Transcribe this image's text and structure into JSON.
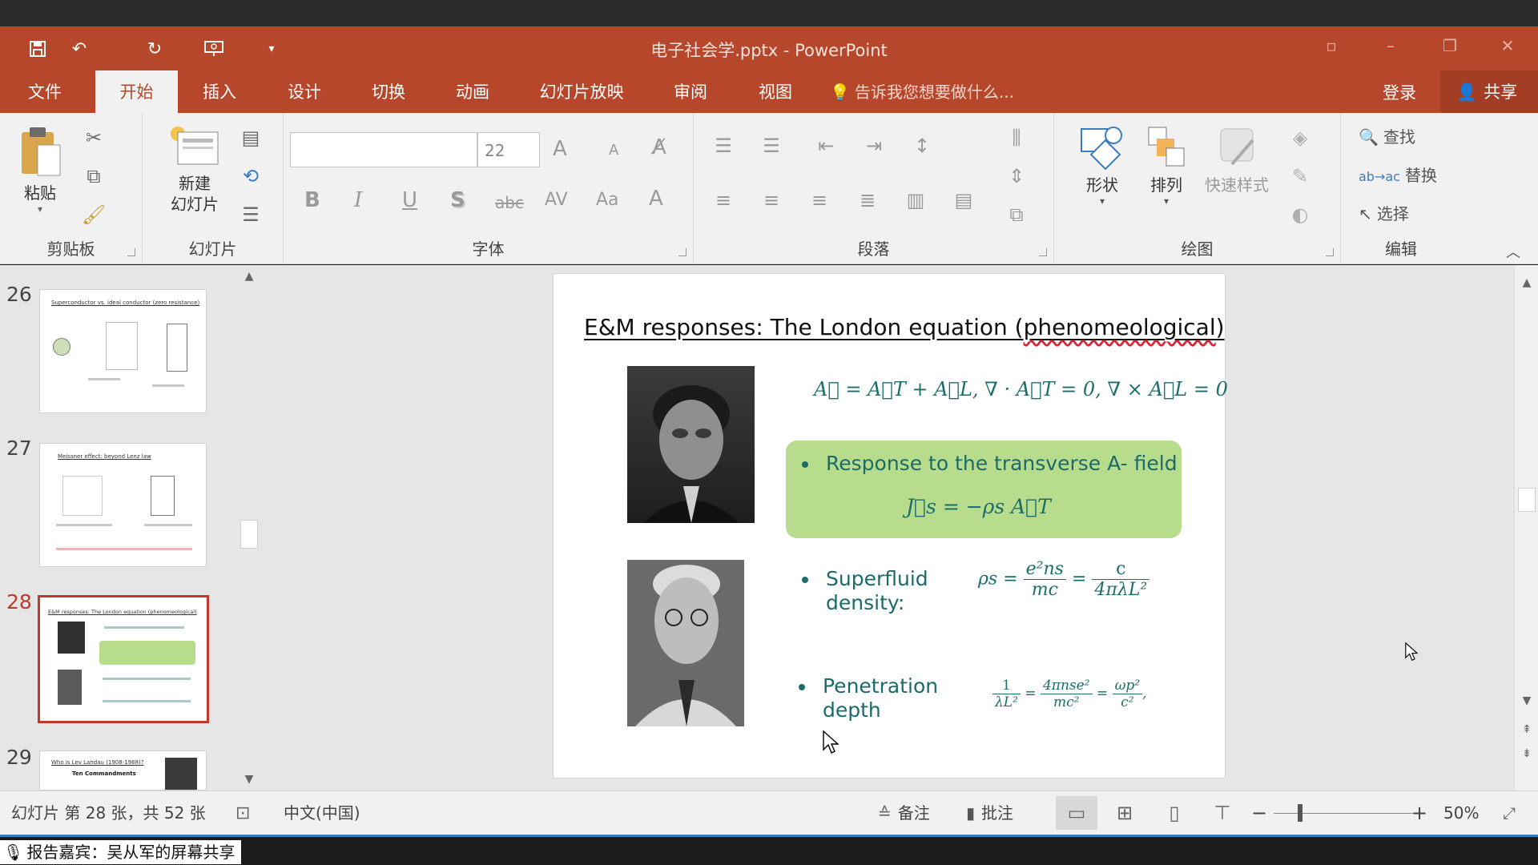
{
  "window": {
    "title": "电子社会学.pptx - PowerPoint"
  },
  "quick_access": {
    "save_icon": "save-icon",
    "undo_icon": "undo-icon",
    "redo_icon": "redo-icon",
    "present_icon": "present-icon",
    "more_icon": "dropdown-icon"
  },
  "tabs": [
    {
      "label": "文件"
    },
    {
      "label": "开始",
      "active": true
    },
    {
      "label": "插入"
    },
    {
      "label": "设计"
    },
    {
      "label": "切换"
    },
    {
      "label": "动画"
    },
    {
      "label": "幻灯片放映"
    },
    {
      "label": "审阅"
    },
    {
      "label": "视图"
    }
  ],
  "tell_me": "告诉我您想要做什么...",
  "account": {
    "login": "登录",
    "share": "共享"
  },
  "ribbon": {
    "clipboard": {
      "label": "剪贴板",
      "paste": "粘贴"
    },
    "slides": {
      "label": "幻灯片",
      "new_slide_line1": "新建",
      "new_slide_line2": "幻灯片"
    },
    "font": {
      "label": "字体",
      "font_name": "",
      "font_size": "22",
      "bold": "B",
      "italic": "I",
      "underline": "U",
      "shadow": "S",
      "strike": "abc",
      "spacing": "AV",
      "case": "Aa",
      "color": "A",
      "grow": "A",
      "shrink": "A"
    },
    "paragraph": {
      "label": "段落"
    },
    "drawing": {
      "label": "绘图",
      "shape": "形状",
      "arrange": "排列",
      "quick_styles": "快速样式"
    },
    "editing": {
      "label": "编辑",
      "find": "查找",
      "replace": "替换",
      "select": "选择"
    }
  },
  "thumbnails": [
    {
      "number": "26",
      "title": "Superconductor vs. ideal conductor (zero resistance)"
    },
    {
      "number": "27",
      "title": "Meissner effect: beyond Lenz law"
    },
    {
      "number": "28",
      "title": "E&M responses: The London equation (phenomeological)",
      "current": true
    },
    {
      "number": "29",
      "title": "Who is Lev Landau (1908-1968)?",
      "subtitle": "Ten Commandments"
    }
  ],
  "slide": {
    "title_main": "E&M responses: The London equation (",
    "title_wavy": "phenomeological",
    "title_end": ")",
    "eq_decomposition": "A⃗ = A⃗T + A⃗L,  ∇ · A⃗T = 0,  ∇ × A⃗L = 0",
    "bullet1": "Response to the transverse A- field",
    "eq_js_lhs": "J⃗s",
    "eq_js_rhs": "= −ρs A⃗T",
    "bullet2_line1": "Superfluid",
    "bullet2_line2": "density:",
    "rho_lhs": "ρs =",
    "rho_num1": "e²ns",
    "rho_den1": "mc",
    "rho_eq": "=",
    "rho_num2": "c",
    "rho_den2": "4πλL²",
    "bullet3_line1": "Penetration",
    "bullet3_line2": "depth",
    "pen_num1": "1",
    "pen_den1": "λL²",
    "pen_eq1": "=",
    "pen_num2": "4πnse²",
    "pen_den2": "mc²",
    "pen_eq2": "=",
    "pen_num3": "ωp²",
    "pen_den3": "c²",
    "pen_end": ","
  },
  "status": {
    "slide_info": "幻灯片 第 28 张，共 52 张",
    "language": "中文(中国)",
    "notes": "备注",
    "comments": "批注",
    "zoom": "50%"
  },
  "share_banner": "报告嘉宾：吴从军的屏幕共享"
}
